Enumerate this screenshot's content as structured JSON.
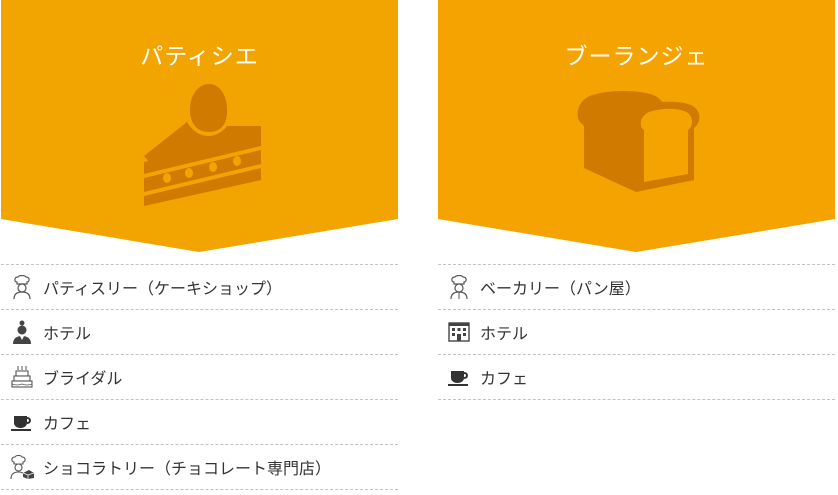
{
  "colors": {
    "banner_left": "#f2a500",
    "banner_right": "#f4a300",
    "icon_dark": "#d07a00",
    "text": "#333333",
    "divider": "#c2c2c2"
  },
  "patissier": {
    "title": "パティシエ",
    "icon": "cake-icon",
    "items": [
      {
        "label": "パティスリー（ケーキショップ）",
        "icon": "chef-icon"
      },
      {
        "label": "ホテル",
        "icon": "hotel-staff-icon"
      },
      {
        "label": "ブライダル",
        "icon": "wedding-cake-icon"
      },
      {
        "label": "カフェ",
        "icon": "coffee-cup-icon"
      },
      {
        "label": "ショコラトリー（チョコレート専門店）",
        "icon": "chocolatier-icon"
      }
    ]
  },
  "boulanger": {
    "title": "ブーランジェ",
    "icon": "bread-icon",
    "items": [
      {
        "label": "ベーカリー（パン屋）",
        "icon": "baker-icon"
      },
      {
        "label": "ホテル",
        "icon": "building-icon"
      },
      {
        "label": "カフェ",
        "icon": "coffee-cup-icon"
      }
    ]
  }
}
